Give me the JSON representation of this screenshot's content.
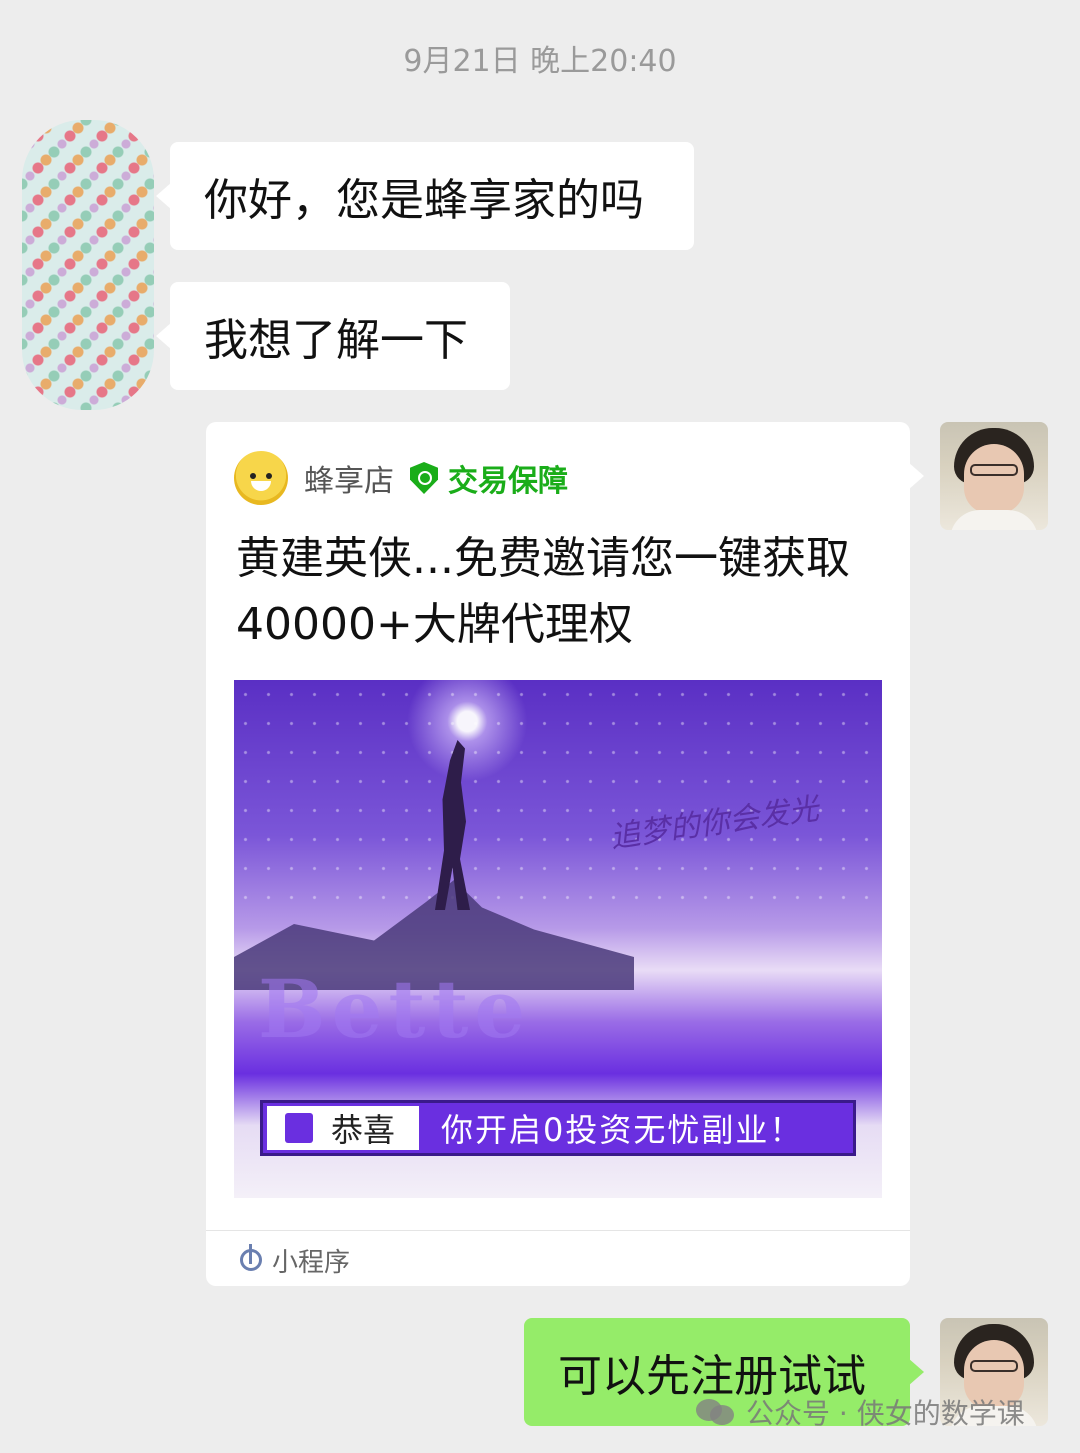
{
  "chat": {
    "timestamp": "9月21日 晚上20:40",
    "messages_in": [
      {
        "text": "你好，您是蜂享家的吗"
      },
      {
        "text": "我想了解一下"
      }
    ],
    "message_out": {
      "text": "可以先注册试试"
    }
  },
  "card": {
    "shop_name": "蜂享店",
    "guarantee_label": "交易保障",
    "title_line1": "黄建英侠...免费邀请您一键获取",
    "title_line2": "40000+大牌代理权",
    "banner": {
      "slogan": "追梦的你会发光",
      "watermark": "Bette",
      "congrats": "恭喜",
      "promo": "你开启0投资无忧副业！"
    },
    "footer_label": "小程序"
  },
  "watermark": {
    "text": "公众号 · 侠女的数学课"
  },
  "colors": {
    "background": "#ededed",
    "bubble_in": "#ffffff",
    "bubble_out": "#95ec69",
    "guarantee_green": "#1aad19",
    "promo_purple": "#6a2fe0"
  }
}
